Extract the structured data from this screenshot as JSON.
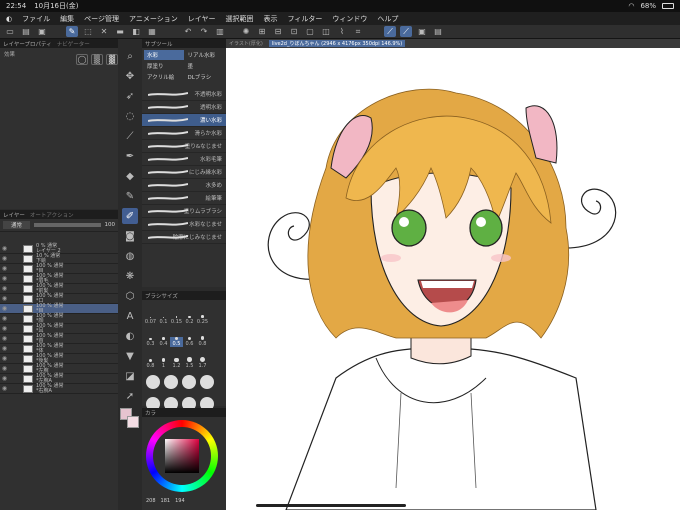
{
  "status": {
    "time": "22:54",
    "date": "10月16日(金)",
    "battery": "68%"
  },
  "menu": [
    "ファイル",
    "編集",
    "ページ管理",
    "アニメーション",
    "レイヤー",
    "選択範囲",
    "表示",
    "フィルター",
    "ウィンドウ",
    "ヘルプ"
  ],
  "panels": {
    "layer_property": "レイヤープロパティ",
    "layer_property_tab2": "ナビゲーター",
    "effect": "効果",
    "subtool": "サブツール",
    "subtool_tabs": [
      "水彩",
      "リアル水彩",
      "厚塗り",
      "墨",
      "アクリル絵",
      "DLブラシ"
    ],
    "layer": "レイヤー",
    "layer_tab2": "オートアクション",
    "brush_size": "ブラシサイズ",
    "color": "カラ",
    "canvas_tab": "イラスト(厚化)",
    "doc_tab": "live2d_りぼんちゃん (2946 x 4176px 350dpi 146.9%)"
  },
  "brushes": [
    "不透明水彩",
    "透明水彩",
    "濃い水彩",
    "滑らか水彩",
    "塗り&なじませ",
    "水彩毛筆",
    "にじみ縁水彩",
    "水多め",
    "絵筆筆",
    "塗りムラブラシ",
    "水彩なじませ",
    "輪廓にじみなじませ"
  ],
  "selected_brush": "濃い水彩",
  "layer_controls": {
    "blend": "通常",
    "opacity": "100"
  },
  "layers": [
    {
      "l1": "0 % 通常",
      "l2": "レイヤー 2"
    },
    {
      "l1": "10 % 通常",
      "l2": "下絵"
    },
    {
      "l1": "100 % 通常",
      "l2": "*目"
    },
    {
      "l1": "100 % 通常",
      "l2": "*眉毛"
    },
    {
      "l1": "100 % 通常",
      "l2": "*前髪"
    },
    {
      "l1": "100 % 通常",
      "l2": "*口"
    },
    {
      "l1": "100 % 通常",
      "l2": "*目"
    },
    {
      "l1": "100 % 通常",
      "l2": "*顔"
    },
    {
      "l1": "100 % 通常",
      "l2": "*耳"
    },
    {
      "l1": "100 % 通常",
      "l2": "*首"
    },
    {
      "l1": "100 % 通常",
      "l2": "*体"
    },
    {
      "l1": "100 % 通常",
      "l2": "*後髪"
    },
    {
      "l1": "100 % 通常",
      "l2": "*左腕"
    },
    {
      "l1": "100 % 通常",
      "l2": "*左腕A"
    },
    {
      "l1": "100 % 通常",
      "l2": "*右腕A"
    }
  ],
  "brush_sizes": [
    [
      "0.07",
      "0.1",
      "0.15",
      "0.2",
      "0.25"
    ],
    [
      "0.3",
      "0.4",
      "0.5",
      "0.6",
      "0.8"
    ],
    [
      "0.8",
      "1",
      "1.2",
      "1.5",
      "1.7"
    ]
  ],
  "color_values": {
    "r": "208",
    "g": "181",
    "b": "194"
  },
  "colors": {
    "accent": "#4a6a9c",
    "hair": "#e8b04a",
    "eye": "#5fb043",
    "ribbon": "#f2b7c4"
  }
}
